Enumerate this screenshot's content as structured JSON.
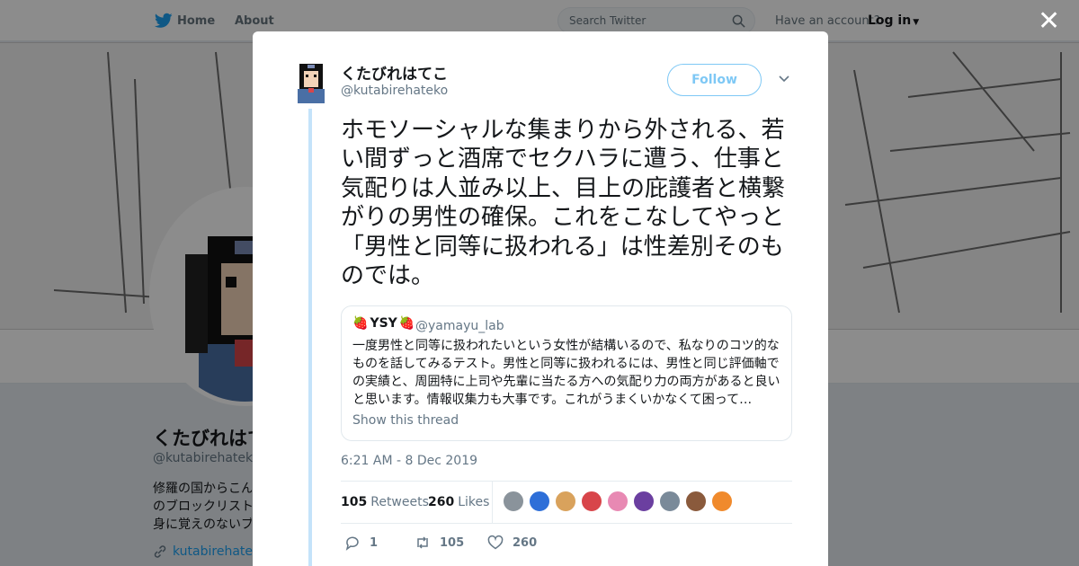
{
  "topbar": {
    "home_label": "Home",
    "about_label": "About",
    "search_placeholder": "Search Twitter",
    "have_account": "Have an account?",
    "login_label": "Log in"
  },
  "profile": {
    "name": "くたびれはて",
    "handle": "@kutabirehateko",
    "bio": "修羅の国からこん\nのブロックリスト\n身に覚えのないブ",
    "link": "kutabirehateko"
  },
  "tweet": {
    "author_name": "くたびれはてこ",
    "author_handle": "@kutabirehateko",
    "follow_label": "Follow",
    "text": "ホモソーシャルな集まりから外される、若い間ずっと酒席でセクハラに遭う、仕事と気配りは人並み以上、目上の庇護者と横繋がりの男性の確保。これをこなしてやっと「男性と同等に扱われる」は性差別そのものでは。",
    "quote": {
      "name": "YSY",
      "name_emoji": "🍓",
      "handle": "@yamayu_lab",
      "text": "一度男性と同等に扱われたいという女性が結構いるので、私なりのコツ的なものを話してみるテスト。男性と同等に扱われるには、男性と同じ評価軸での実績と、周囲特に上司や先輩に当たる方への気配り力の両方があると良いと思います。情報収集力も大事です。これがうまくいかなくて困って…",
      "show_thread": "Show this thread"
    },
    "timestamp": "6:21 AM - 8 Dec 2019",
    "retweets_count": "105",
    "retweets_label": "Retweets",
    "likes_count": "260",
    "likes_label": "Likes",
    "likers_colors": [
      "#8a939b",
      "#2e6fd8",
      "#d9a25c",
      "#d8454a",
      "#e889b3",
      "#6b3fa0",
      "#7a8a99",
      "#8a5a3c",
      "#f08a2c"
    ],
    "reply_count": "1",
    "retweet_action_count": "105",
    "like_action_count": "260"
  },
  "colors": {
    "accent": "#1da1f2",
    "follow": "#7ec8f5",
    "thread_line": "#c4e3fa"
  }
}
